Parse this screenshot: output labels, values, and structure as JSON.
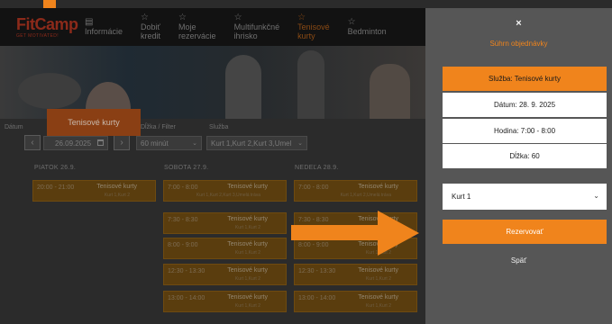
{
  "header": {
    "logo_main": "FitCamp",
    "logo_sub": "GET MOTIVATED!",
    "nav": [
      {
        "icon": "document-icon",
        "glyph": "▤",
        "label1": "Informácie",
        "label2": ""
      },
      {
        "icon": "star-icon",
        "glyph": "☆",
        "label1": "Dobiť",
        "label2": "kredit"
      },
      {
        "icon": "star-icon",
        "glyph": "☆",
        "label1": "Moje",
        "label2": "rezervácie"
      },
      {
        "icon": "star-icon",
        "glyph": "☆",
        "label1": "Multifunkčné",
        "label2": "ihrisko"
      },
      {
        "icon": "star-icon",
        "glyph": "☆",
        "label1": "Tenisové",
        "label2": "kurty"
      },
      {
        "icon": "star-icon",
        "glyph": "☆",
        "label1": "Bedminton",
        "label2": ""
      }
    ]
  },
  "hero": {
    "tag": "Tenisové kurty"
  },
  "filters": {
    "date_label": "Dátum",
    "date_value": "26.09.2025",
    "length_label": "Dĺžka / Filter",
    "length_value": "60 minút",
    "service_label": "Služba",
    "service_value": "Kurt 1,Kurt 2,Kurt 3,Umel"
  },
  "schedule": {
    "days": [
      "PIATOK 26.9.",
      "SOBOTA 27.9.",
      "NEDEĽA 28.9."
    ],
    "columns": [
      [
        {
          "time": "20:00 - 21:00",
          "service": "Tenisové kurty",
          "courts": "Kurt 1,Kurt 2"
        }
      ],
      [
        {
          "time": "7:00 - 8:00",
          "service": "Tenisové kurty",
          "courts": "Kurt 1,Kurt 2,Kurt 3,Umelá tráva"
        },
        {
          "time": "7:30 - 8:30",
          "service": "Tenisové kurty",
          "courts": "Kurt 1,Kurt 2"
        },
        {
          "time": "8:00 - 9:00",
          "service": "Tenisové kurty",
          "courts": "Kurt 1,Kurt 2"
        },
        {
          "time": "12:30 - 13:30",
          "service": "Tenisové kurty",
          "courts": "Kurt 1,Kurt 2"
        },
        {
          "time": "13:00 - 14:00",
          "service": "Tenisové kurty",
          "courts": "Kurt 1,Kurt 2"
        }
      ],
      [
        {
          "time": "7:00 - 8:00",
          "service": "Tenisové kurty",
          "courts": "Kurt 1,Kurt 2,Umelá tráva"
        },
        {
          "time": "7:30 - 8:30",
          "service": "Tenisové kurty",
          "courts": "Kurt 1,Kurt 2"
        },
        {
          "time": "8:00 - 9:00",
          "service": "Tenisové kurty",
          "courts": "Kurt 1,Kurt 2"
        },
        {
          "time": "12:30 - 13:30",
          "service": "Tenisové kurty",
          "courts": "Kurt 1,Kurt 2"
        },
        {
          "time": "13:00 - 14:00",
          "service": "Tenisové kurty",
          "courts": "Kurt 1,Kurt 2"
        }
      ]
    ]
  },
  "panel": {
    "close": "×",
    "title": "Súhrn objednávky",
    "service": "Služba: Tenisové kurty",
    "date": "Dátum: 28. 9. 2025",
    "time": "Hodina: 7:00 - 8:00",
    "length": "Dĺžka: 60",
    "court": "Kurt 1",
    "reserve": "Rezervovať",
    "back": "Späť"
  },
  "colors": {
    "accent": "#f0841c",
    "panel_bg": "#565656",
    "overlay_bg": "#2b2b2b"
  }
}
